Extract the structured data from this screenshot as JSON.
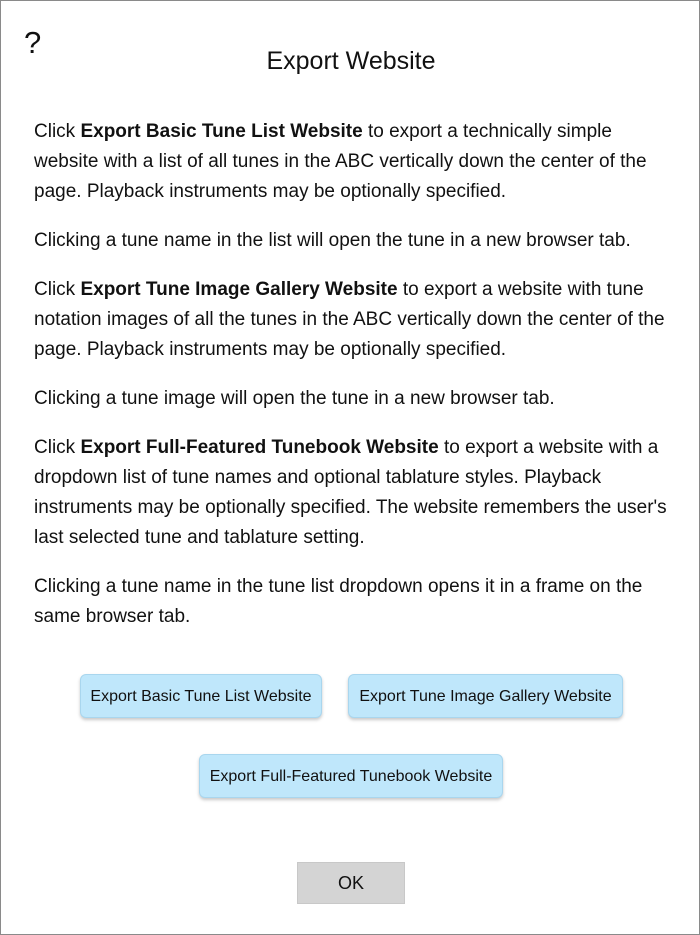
{
  "dialog": {
    "help_icon": "?",
    "title": "Export Website"
  },
  "paragraphs": [
    {
      "pre": "Click ",
      "bold": "Export Basic Tune List Website",
      "post": " to export a technically simple website with a list of all tunes in the ABC vertically down the center of the page. Playback instruments may be optionally specified."
    },
    {
      "text": "Clicking a tune name in the list will open the tune in a new browser tab."
    },
    {
      "pre": "Click ",
      "bold": "Export Tune Image Gallery Website",
      "post": " to export a website with tune notation images of all the tunes in the ABC vertically down the center of the page. Playback instruments may be optionally specified."
    },
    {
      "text": "Clicking a tune image will open the tune in a new browser tab."
    },
    {
      "pre": "Click ",
      "bold": "Export Full-Featured Tunebook Website",
      "post": " to export a website with a dropdown list of tune names and optional tablature styles. Playback instruments may be optionally specified. The website remembers the user's last selected tune and tablature setting."
    },
    {
      "text": "Clicking a tune name in the tune list dropdown opens it in a frame on the same browser tab."
    }
  ],
  "buttons": {
    "basic": "Export Basic Tune List Website",
    "gallery": "Export Tune Image Gallery Website",
    "full": "Export Full-Featured Tunebook Website",
    "ok": "OK"
  },
  "colors": {
    "action_button_bg": "#bfe7fb",
    "ok_button_bg": "#d4d4d4",
    "dialog_border": "#8a8a8a"
  }
}
